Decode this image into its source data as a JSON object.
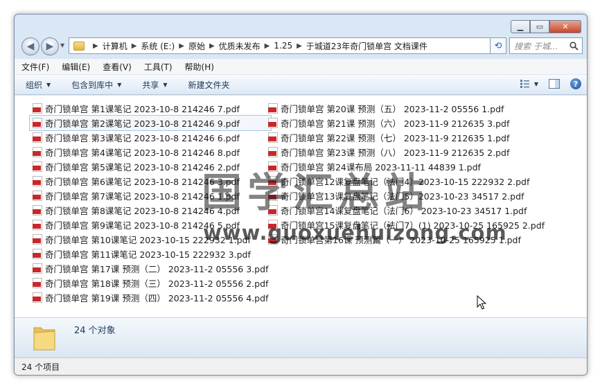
{
  "breadcrumb": [
    "计算机",
    "系统 (E:)",
    "原始",
    "优质未发布",
    "1.25",
    "于城道23年奇门锁单宫  文档课件"
  ],
  "search_placeholder": "搜索 于城...",
  "menu": [
    "文件(F)",
    "编辑(E)",
    "查看(V)",
    "工具(T)",
    "帮助(H)"
  ],
  "toolbar": {
    "organize": "组织",
    "include_library": "包含到库中",
    "share": "共享",
    "new_folder": "新建文件夹"
  },
  "files_left": [
    "奇门锁单宫 第1课笔记 2023-10-8 214246 7.pdf",
    "奇门锁单宫 第2课笔记 2023-10-8 214246 9.pdf",
    "奇门锁单宫 第3课笔记 2023-10-8 214246 6.pdf",
    "奇门锁单宫 第4课笔记 2023-10-8 214246 8.pdf",
    "奇门锁单宫 第5课笔记 2023-10-8 214246 2.pdf",
    "奇门锁单宫 第6课笔记 2023-10-8 214246 3.pdf",
    "奇门锁单宫 第7课笔记 2023-10-8 214246 1.pdf",
    "奇门锁单宫 第8课笔记 2023-10-8 214246 4.pdf",
    "奇门锁单宫 第9课笔记 2023-10-8 214246 5.pdf",
    "奇门锁单宫 第10课笔记 2023-10-15 222932 1.pdf",
    "奇门锁单宫 第11课笔记 2023-10-15 222932 3.pdf",
    "奇门锁单宫 第17课 预测（二） 2023-11-2 05556 3.pdf",
    "奇门锁单宫 第18课 预测（三） 2023-11-2 05556 2.pdf",
    "奇门锁单宫 第19课 预测（四） 2023-11-2 05556 4.pdf"
  ],
  "files_right": [
    "奇门锁单宫 第20课 预测（五） 2023-11-2 05556 1.pdf",
    "奇门锁单宫 第21课 预测（六） 2023-11-9 212635 3.pdf",
    "奇门锁单宫 第22课 预测（七） 2023-11-9 212635 1.pdf",
    "奇门锁单宫 第23课 预测（八） 2023-11-9 212635 2.pdf",
    "奇门锁单宫 第24课布局 2023-11-11 44839 1.pdf",
    "奇门锁单宫12课复盘笔记（法门4）2023-10-15 222932 2.pdf",
    "奇门锁单宫13课复盘笔记（法门5）2023-10-23 34517 2.pdf",
    "奇门锁单宫14课复盘笔记（法门6） 2023-10-23 34517 1.pdf",
    "奇门锁单宫15课复盘笔记（法门7）(1) 2023-10-25 165925 2.pdf",
    "奇门锁单宫第16课 预测篇（一） 2023-10-25 165925 1.pdf"
  ],
  "watermark_cn": "国学汇总站",
  "watermark_url": "www.guoxuehuizong.com",
  "detail_count": "24 个对象",
  "status_text": "24 个项目"
}
